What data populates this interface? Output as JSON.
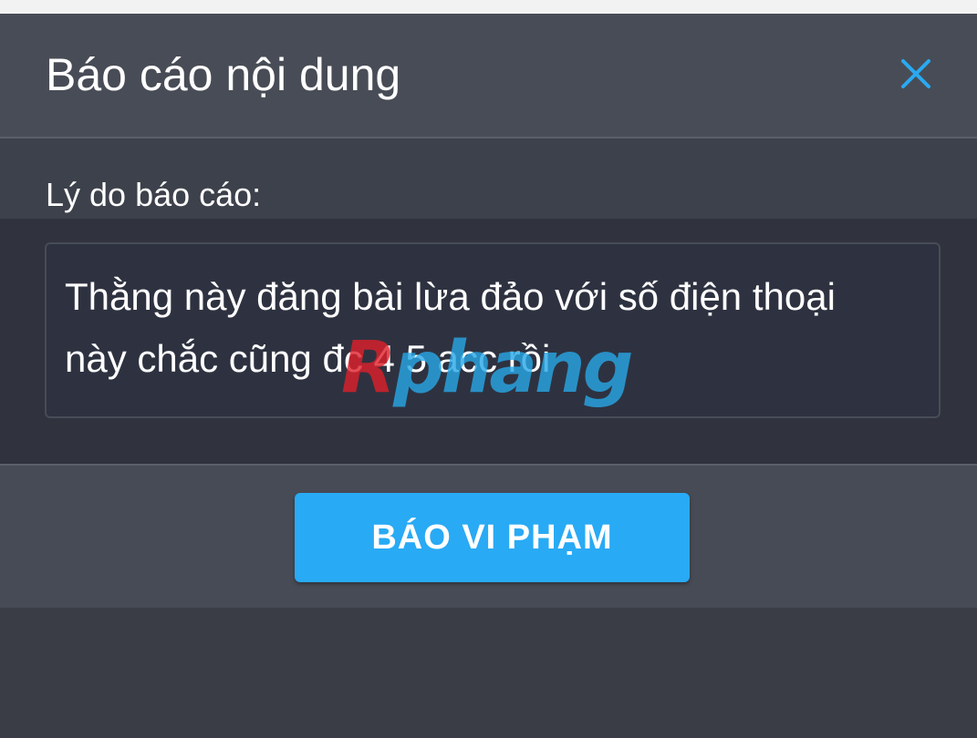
{
  "dialog": {
    "title": "Báo cáo nội dung",
    "close_icon": "close-icon"
  },
  "form": {
    "reason_label": "Lý do báo cáo:",
    "reason_text": "Thằng này đăng bài lừa đảo với số điện thoại này chắc cũng đc 4 5 acc rồi"
  },
  "footer": {
    "submit_label": "BÁO VI PHẠM"
  },
  "watermark": {
    "text": "Rphang"
  },
  "colors": {
    "accent": "#29aaf4",
    "dialog_bg": "#474b55",
    "input_bg": "#2e3240",
    "watermark_red": "#e0202a",
    "watermark_blue": "#28a8e8"
  }
}
